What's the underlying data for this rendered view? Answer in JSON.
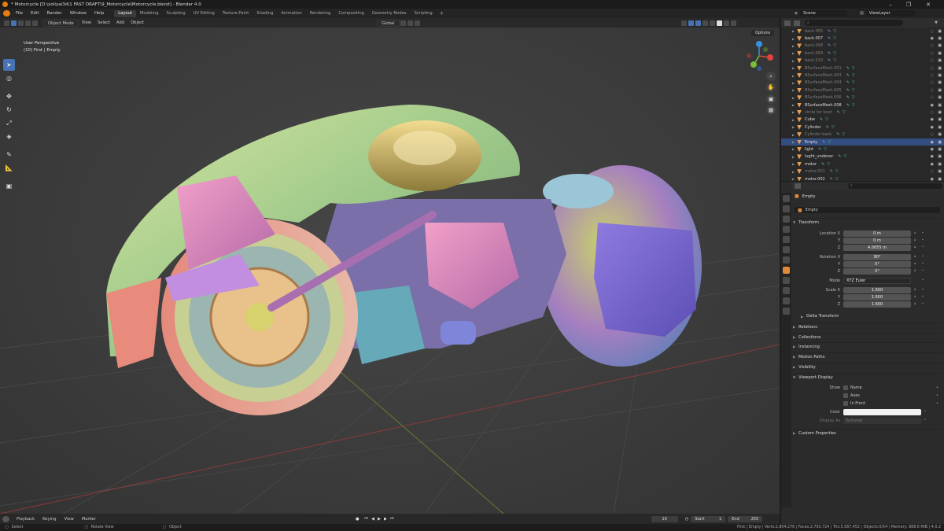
{
  "window": {
    "title": "* Motorcycle [D:\\yoliyai3d\\1 FAST DRAFT\\9_Motorcycle\\Motorcycle.blend] - Blender 4.0"
  },
  "menu": {
    "items": [
      "File",
      "Edit",
      "Render",
      "Window",
      "Help"
    ],
    "workspaces": [
      "Layout",
      "Modeling",
      "Sculpting",
      "UV Editing",
      "Texture Paint",
      "Shading",
      "Animation",
      "Rendering",
      "Compositing",
      "Geometry Nodes",
      "Scripting"
    ],
    "active_workspace": "Layout",
    "scene_label": "Scene",
    "view_layer_label": "ViewLayer"
  },
  "viewport": {
    "mode": "Object Mode",
    "header_menus": [
      "View",
      "Select",
      "Add",
      "Object"
    ],
    "transform_orientation": "Global",
    "options_label": "Options",
    "overlay_line1": "User Perspective",
    "overlay_line2": "(10) First | Empty",
    "gizmo_axes": {
      "x": "#e0443c",
      "y": "#7cbd3a",
      "z": "#3b8fe0"
    }
  },
  "outliner": {
    "rows": [
      {
        "name": "back.005",
        "dim": true,
        "selected": false
      },
      {
        "name": "back.007",
        "dim": false,
        "selected": false
      },
      {
        "name": "back.008",
        "dim": true,
        "selected": false
      },
      {
        "name": "back.009",
        "dim": true,
        "selected": false
      },
      {
        "name": "back.010",
        "dim": true,
        "selected": false
      },
      {
        "name": "BSurfaceMesh.001",
        "dim": true,
        "selected": false
      },
      {
        "name": "BSurfaceMesh.003",
        "dim": true,
        "selected": false
      },
      {
        "name": "BSurfaceMesh.004",
        "dim": true,
        "selected": false
      },
      {
        "name": "BSurfaceMesh.005",
        "dim": true,
        "selected": false
      },
      {
        "name": "BSurfaceMesh.006",
        "dim": true,
        "selected": false
      },
      {
        "name": "BSurfaceMesh.008",
        "dim": false,
        "selected": false
      },
      {
        "name": "circle for boot",
        "dim": true,
        "selected": false
      },
      {
        "name": "Cube",
        "dim": false,
        "selected": false
      },
      {
        "name": "Cylinder",
        "dim": false,
        "selected": false
      },
      {
        "name": "Cylinder back",
        "dim": true,
        "selected": false
      },
      {
        "name": "Empty",
        "dim": false,
        "selected": true
      },
      {
        "name": "light",
        "dim": false,
        "selected": false
      },
      {
        "name": "lught_undener",
        "dim": false,
        "selected": false
      },
      {
        "name": "motor",
        "dim": false,
        "selected": false
      },
      {
        "name": "motor.001",
        "dim": true,
        "selected": false
      },
      {
        "name": "motor.002",
        "dim": false,
        "selected": false
      }
    ]
  },
  "properties": {
    "object_name_header": "Empty",
    "object_name_field": "Empty",
    "transform_title": "Transform",
    "location": {
      "label": "Location X",
      "x": "0 m",
      "y": "0 m",
      "z": "4.0055 m"
    },
    "rotation": {
      "label": "Rotation X",
      "x": "90°",
      "y": "0°",
      "z": "0°"
    },
    "mode_label": "Mode",
    "mode_value": "XYZ Euler",
    "scale": {
      "label": "Scale X",
      "x": "1.600",
      "y": "1.600",
      "z": "1.600"
    },
    "axis_labels": {
      "y": "Y",
      "z": "Z"
    },
    "delta_transform": "Delta Transform",
    "sections": [
      "Relations",
      "Collections",
      "Instancing",
      "Motion Paths",
      "Visibility"
    ],
    "viewport_display": "Viewport Display",
    "show_label": "Show",
    "show_options": [
      "Name",
      "Axes",
      "In Front"
    ],
    "color_label": "Color",
    "display_as_label": "Display As",
    "display_as_value": "Textured",
    "custom_properties": "Custom Properties"
  },
  "timeline": {
    "menus": [
      "Playback",
      "Keying",
      "View",
      "Marker"
    ],
    "current_frame": "10",
    "start_label": "Start",
    "start_value": "1",
    "end_label": "End",
    "end_value": "250"
  },
  "statusbar": {
    "select": "Select",
    "rotate_view": "Rotate View",
    "object": "Object",
    "stats": "First | Empty | Verts:2,804,276 | Faces:2,793,724 | Tris:5,587,452 | Objects:0/54 | Memory: 888.6 MiB | 4.0.2"
  }
}
